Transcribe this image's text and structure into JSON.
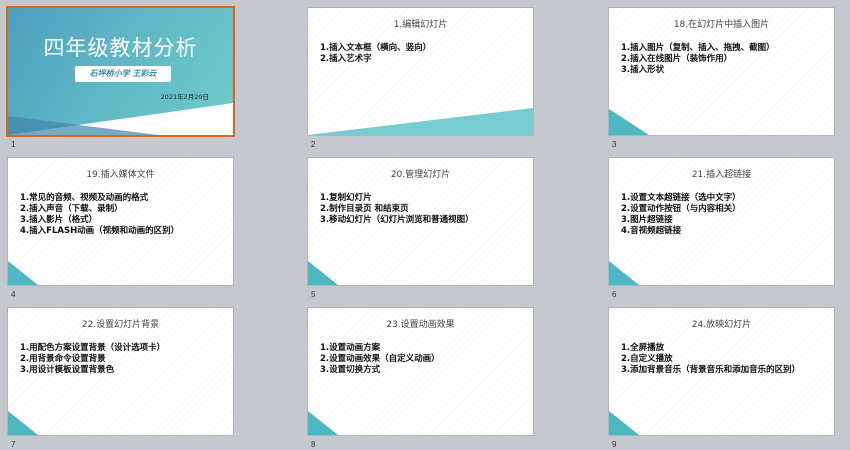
{
  "slides": [
    {
      "number": "1",
      "title": "四年级教材分析",
      "subtitle": "石坪桥小学    王彩云",
      "date": "2021年2月20日",
      "selected": true
    },
    {
      "number": "2",
      "title": "1.编辑幻灯片",
      "items": [
        "1.插入文本框（横向、竖向）",
        "2.插入艺术字"
      ]
    },
    {
      "number": "3",
      "title": "18.在幻灯片中插入图片",
      "items": [
        "1.插入图片（复制、插入、拖拽、截图）",
        "2.插入在线图片（装饰作用）",
        "3.插入形状"
      ]
    },
    {
      "number": "4",
      "title": "19.插入媒体文件",
      "items": [
        "1.常见的音频、视频及动画的格式",
        "2.插入声音（下载、录制）",
        "3.插入影片（格式）",
        "4.插入FLASH动画（视频和动画的区别）"
      ]
    },
    {
      "number": "5",
      "title": "20.管理幻灯片",
      "items": [
        "1.复制幻灯片",
        "2.制作目录页 和结束页",
        "3.移动幻灯片（幻灯片浏览和普通视图）"
      ]
    },
    {
      "number": "6",
      "title": "21.插入超链接",
      "items": [
        "1.设置文本超链接（选中文字）",
        "2.设置动作按钮（与内容相关）",
        "3.图片超链接",
        "4.音视频超链接"
      ]
    },
    {
      "number": "7",
      "title": "22.设置幻灯片背景",
      "items": [
        "1.用配色方案设置背景（设计选项卡）",
        "2.用背景命令设置背景",
        "3.用设计模板设置背景色"
      ]
    },
    {
      "number": "8",
      "title": "23.设置动画效果",
      "items": [
        "1.设置动画方案",
        "2.设置动画效果（自定义动画）",
        "3.设置切换方式"
      ]
    },
    {
      "number": "9",
      "title": "24.放映幻灯片",
      "items": [
        "1.全屏播放",
        "2.自定义播放",
        "3.添加背景音乐（背景音乐和添加音乐的区别）"
      ]
    }
  ]
}
